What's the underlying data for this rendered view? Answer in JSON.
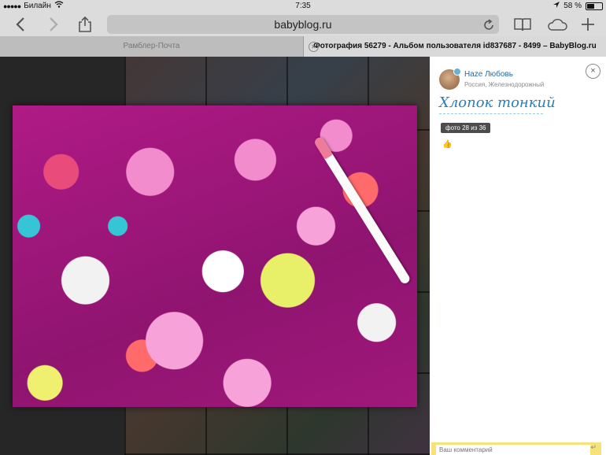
{
  "status_bar": {
    "carrier": "Билайн",
    "time": "7:35",
    "battery_pct": "58 %",
    "battery_level": 0.58
  },
  "toolbar": {
    "url": "babyblog.ru",
    "icons": [
      "back-icon",
      "forward-icon",
      "share-icon",
      "reload-icon",
      "bookmarks-icon",
      "icloud-tabs-icon",
      "new-tab-icon"
    ]
  },
  "tabs": [
    {
      "title": "Рамблер-Почта",
      "active": false
    },
    {
      "title": "Фотография 56279 - Альбом пользователя id837687 - 8499 – BabyBlog.ru",
      "active": true
    }
  ],
  "viewer": {
    "photo_alt": "",
    "user_name": "Haze Любовь",
    "user_location": "Россия, Железнодорожный",
    "photo_title": "Хлопок тонкий",
    "counter": "фото 28 из 36",
    "close_label": "×",
    "comment_placeholder": "Ваш комментарий"
  },
  "colors": {
    "link": "#2a6aa0",
    "title": "#2a7fb6",
    "comment_bar": "#f7e27a"
  }
}
